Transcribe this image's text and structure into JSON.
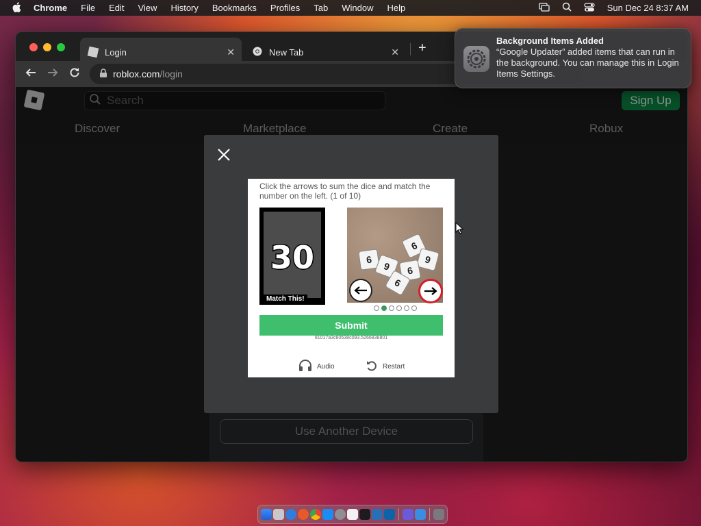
{
  "menubar": {
    "app_name": "Chrome",
    "menus": [
      "File",
      "Edit",
      "View",
      "History",
      "Bookmarks",
      "Profiles",
      "Tab",
      "Window",
      "Help"
    ],
    "datetime": "Sun Dec 24  8:37 AM"
  },
  "browser": {
    "tabs": [
      {
        "title": "Login",
        "icon": "roblox-icon",
        "active": true
      },
      {
        "title": "New Tab",
        "icon": "chrome-icon",
        "active": false
      }
    ],
    "new_tab_glyph": "+",
    "url_host": "roblox.com",
    "url_path": "/login"
  },
  "roblox": {
    "search_placeholder": "Search",
    "signup_label": "Sign Up",
    "nav": [
      "Discover",
      "Marketplace",
      "Create",
      "Robux"
    ],
    "another_device_label": "Use Another Device"
  },
  "captcha": {
    "instruction": "Click the arrows to sum the dice and match the number on the left. (1 of 10)",
    "target_number": "30",
    "match_label": "Match This!",
    "progress": {
      "total": 6,
      "current": 2
    },
    "submit_label": "Submit",
    "token": "81017a3c80538c093.5266838801",
    "audio_label": "Audio",
    "restart_label": "Restart",
    "dice_faces": [
      "6",
      "9",
      "6",
      "9",
      "6",
      "6"
    ]
  },
  "notification": {
    "title": "Background Items Added",
    "body": "“Google Updater” added items that can run in the background. You can manage this in Login Items Settings."
  },
  "colors": {
    "signup_green": "#0b7a3e",
    "submit_green": "#3fbf6e",
    "arrow_ring_red": "#d31f2b"
  }
}
